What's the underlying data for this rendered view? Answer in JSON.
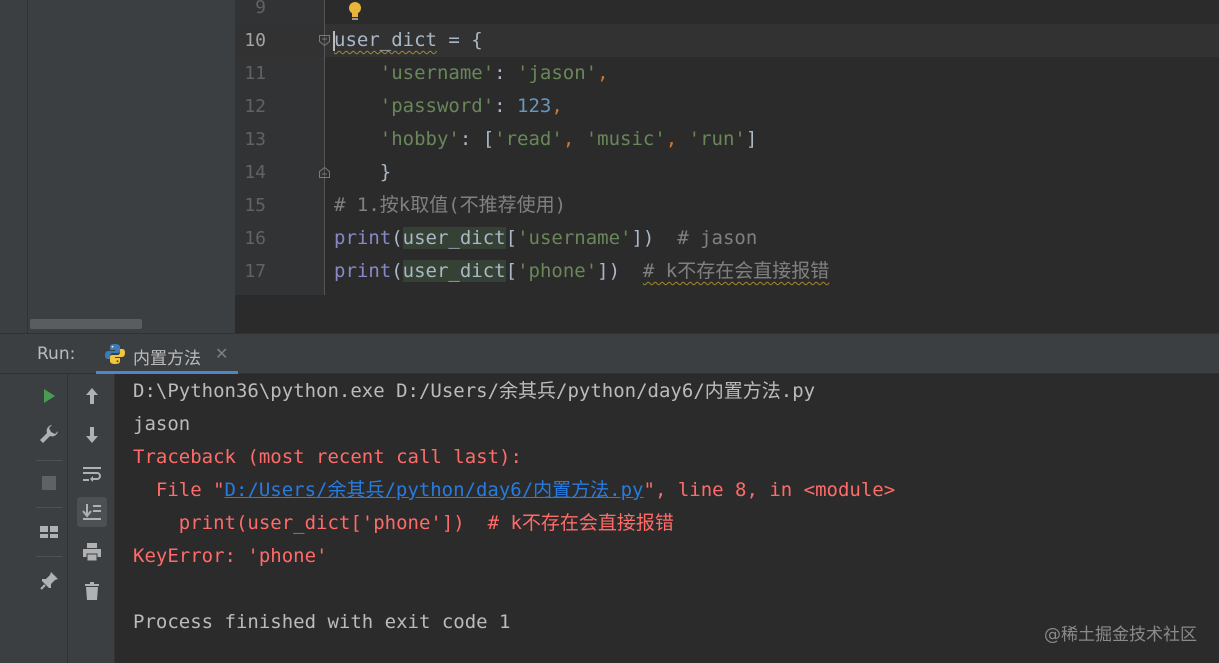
{
  "editor": {
    "lines": [
      {
        "num": "9"
      },
      {
        "num": "10",
        "segments": [
          {
            "t": "user_dict",
            "c": "kw wavy"
          },
          {
            "t": " = {",
            "c": "kw"
          }
        ]
      },
      {
        "num": "11",
        "segments": [
          {
            "t": "    "
          },
          {
            "t": "'username'",
            "c": "str"
          },
          {
            "t": ": "
          },
          {
            "t": "'jason'",
            "c": "str"
          },
          {
            "t": ",",
            "c": "orange"
          }
        ]
      },
      {
        "num": "12",
        "segments": [
          {
            "t": "    "
          },
          {
            "t": "'password'",
            "c": "str"
          },
          {
            "t": ": "
          },
          {
            "t": "123",
            "c": "num"
          },
          {
            "t": ",",
            "c": "orange"
          }
        ]
      },
      {
        "num": "13",
        "segments": [
          {
            "t": "    "
          },
          {
            "t": "'hobby'",
            "c": "str"
          },
          {
            "t": ": ["
          },
          {
            "t": "'read'",
            "c": "str"
          },
          {
            "t": ", ",
            "c": "orange"
          },
          {
            "t": "'music'",
            "c": "str"
          },
          {
            "t": ", ",
            "c": "orange"
          },
          {
            "t": "'run'",
            "c": "str"
          },
          {
            "t": "]"
          }
        ]
      },
      {
        "num": "14",
        "segments": [
          {
            "t": "    }"
          }
        ]
      },
      {
        "num": "15",
        "segments": [
          {
            "t": "# 1.按k取值(不推荐使用)",
            "c": "cmt"
          }
        ]
      },
      {
        "num": "16",
        "segments": [
          {
            "t": "print",
            "c": "fn"
          },
          {
            "t": "("
          },
          {
            "t": "user_dict",
            "c": "hl"
          },
          {
            "t": "["
          },
          {
            "t": "'username'",
            "c": "str"
          },
          {
            "t": "])  "
          },
          {
            "t": "# jason",
            "c": "cmt"
          }
        ]
      },
      {
        "num": "17",
        "segments": [
          {
            "t": "print",
            "c": "fn"
          },
          {
            "t": "("
          },
          {
            "t": "user_dict",
            "c": "hl"
          },
          {
            "t": "["
          },
          {
            "t": "'phone'",
            "c": "str"
          },
          {
            "t": "])  "
          },
          {
            "t": "# k不存在会直接报错",
            "c": "cmt wavy"
          }
        ]
      }
    ]
  },
  "run": {
    "label": "Run:",
    "tab_label": "内置方法",
    "close_glyph": "✕"
  },
  "console": {
    "cmd": "D:\\Python36\\python.exe D:/Users/余其兵/python/day6/内置方法.py",
    "out1": "jason",
    "tb_head": "Traceback (most recent call last):",
    "file_pre": "  File \"",
    "file_link": "D:/Users/余其兵/python/day6/内置方法.py",
    "file_post": "\", line 8, in <module>",
    "code_line": "    print(user_dict['phone'])  # k不存在会直接报错",
    "error": "KeyError: 'phone'",
    "finish": "Process finished with exit code 1"
  },
  "watermark": "@稀土掘金技术社区",
  "icons": {
    "toolbar1": [
      "run-icon",
      "wrench-icon",
      "stop-icon",
      "layout-icon",
      "pin-icon"
    ],
    "toolbar2": [
      "arrow-up-icon",
      "arrow-down-icon",
      "soft-wrap-icon",
      "scroll-to-end-icon",
      "print-icon",
      "trash-icon"
    ]
  },
  "colors": {
    "accent": "#4a88c7",
    "error": "#ff6b68",
    "link": "#287bde",
    "run_green": "#499c54"
  }
}
